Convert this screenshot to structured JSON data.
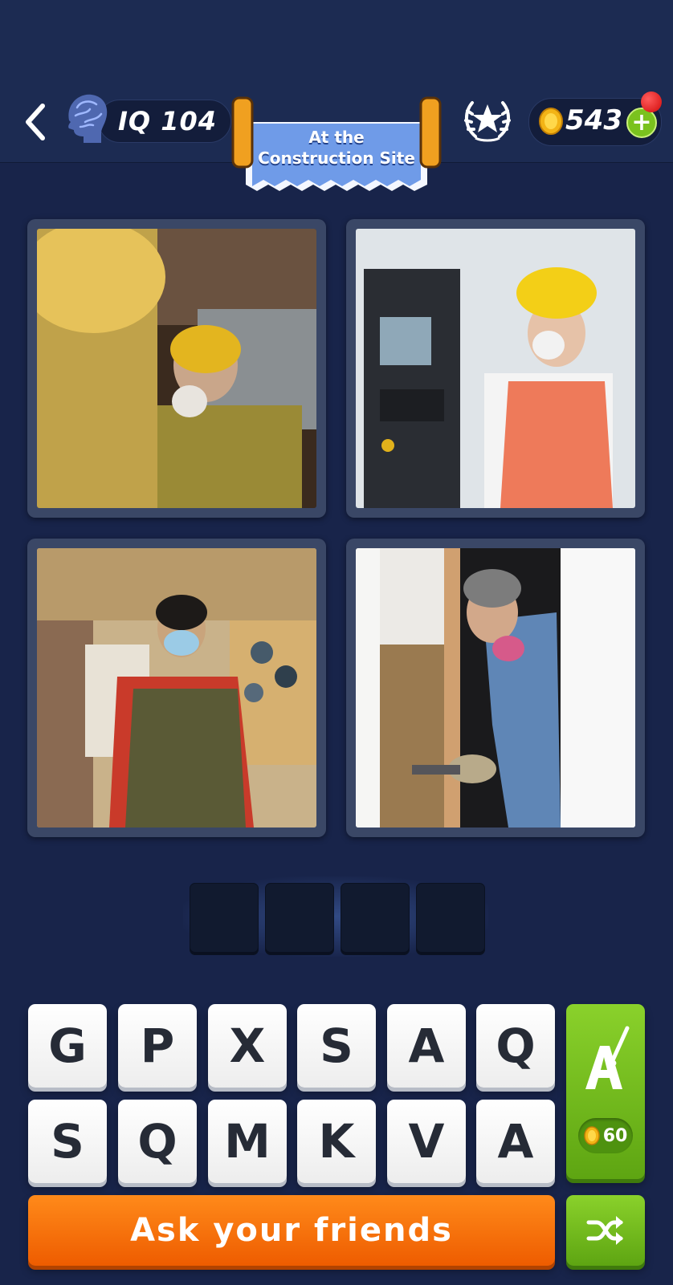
{
  "header": {
    "iq_label": "IQ 104",
    "level_title_line1": "At the",
    "level_title_line2": "Construction Site",
    "coins": "543"
  },
  "puzzle": {
    "photos": [
      {
        "name": "photo-worker-hardhat-mask"
      },
      {
        "name": "photo-woman-control-panel"
      },
      {
        "name": "photo-shop-clerk-mask"
      },
      {
        "name": "photo-man-respirator-wall"
      }
    ],
    "answer_length": 4
  },
  "keyboard": {
    "row1": [
      "G",
      "P",
      "X",
      "S",
      "A",
      "Q"
    ],
    "row2": [
      "S",
      "Q",
      "M",
      "K",
      "V",
      "A"
    ]
  },
  "actions": {
    "hint_cost": "60",
    "ask_label": "Ask your friends"
  },
  "colors": {
    "background": "#18244a",
    "key_face": "#ffffff",
    "green_button": "#6fb61a",
    "orange_button": "#f47010"
  }
}
